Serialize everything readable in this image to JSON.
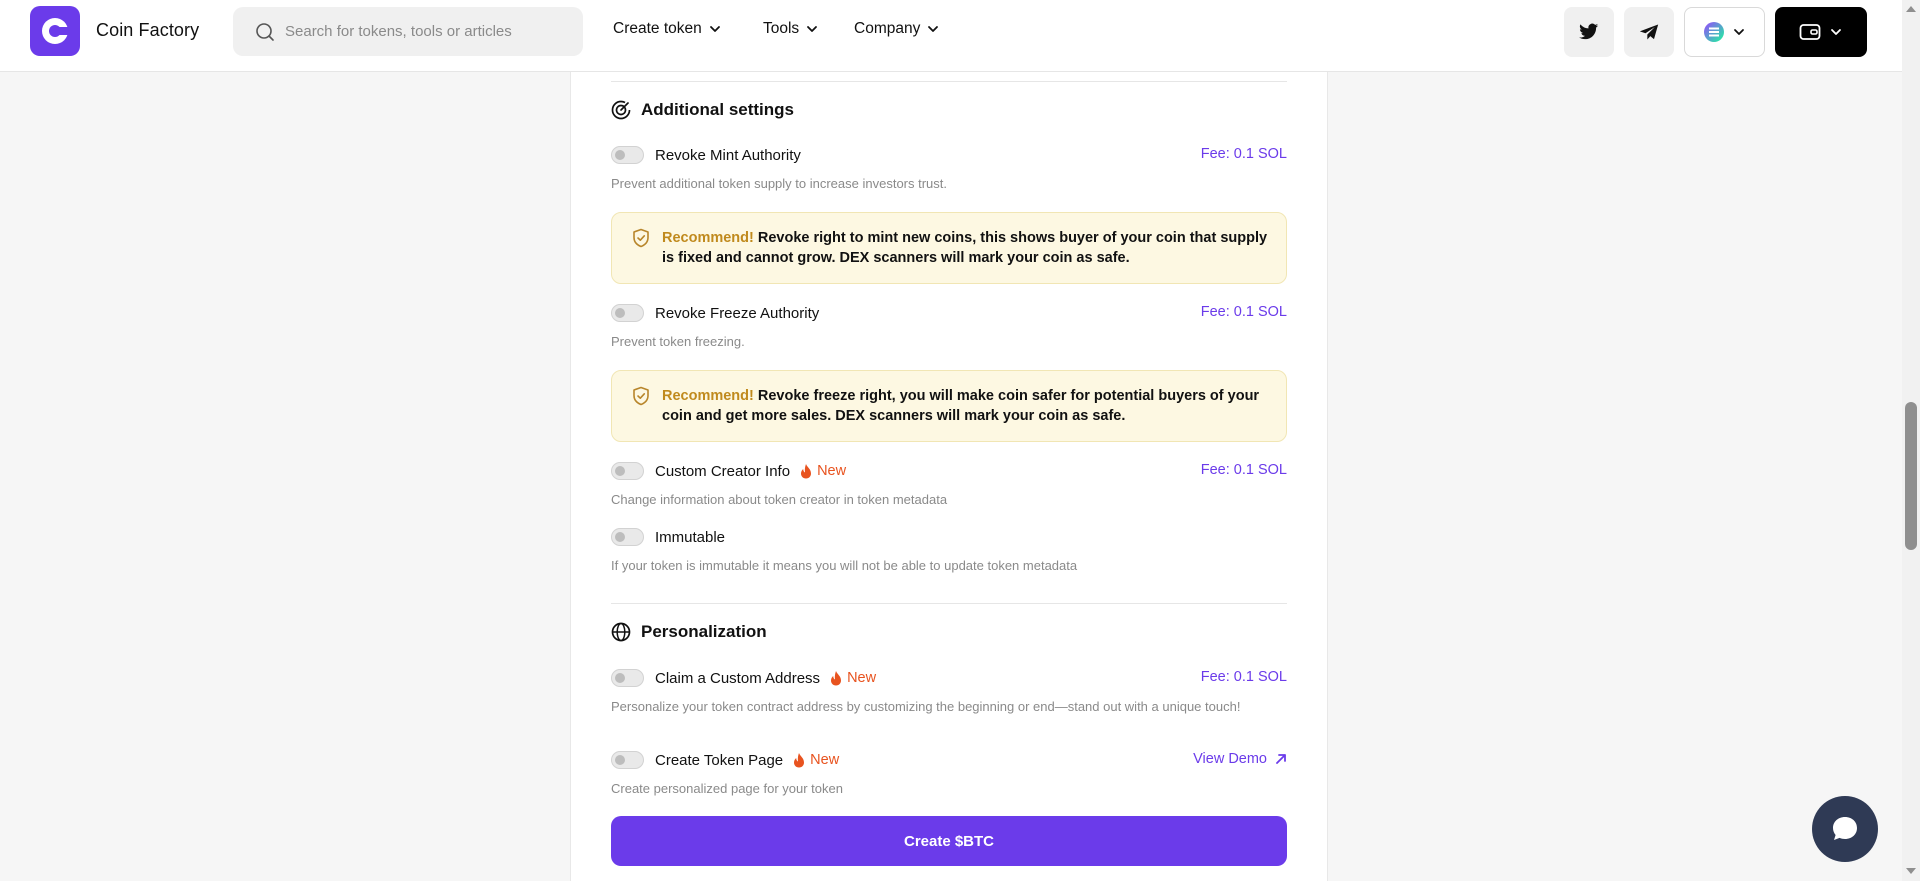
{
  "header": {
    "brand": "Coin Factory",
    "search_placeholder": "Search for tokens, tools or articles",
    "nav": [
      {
        "label": "Create token"
      },
      {
        "label": "Tools"
      },
      {
        "label": "Company"
      }
    ]
  },
  "additional_settings": {
    "title": "Additional settings",
    "revoke_mint": {
      "label": "Revoke Mint Authority",
      "fee": "Fee: 0.1 SOL",
      "description": "Prevent additional token supply to increase investors trust.",
      "recommend_prefix": "Recommend!",
      "recommend_text": " Revoke right to mint new coins, this shows buyer of your coin that supply is fixed and cannot grow. DEX scanners will mark your coin as safe."
    },
    "revoke_freeze": {
      "label": "Revoke Freeze Authority",
      "fee": "Fee: 0.1 SOL",
      "description": "Prevent token freezing.",
      "recommend_prefix": "Recommend!",
      "recommend_text": " Revoke freeze right, you will make coin safer for potential buyers of your coin and get more sales. DEX scanners will mark your coin as safe."
    },
    "custom_creator": {
      "label": "Custom Creator Info",
      "badge": "New",
      "fee": "Fee: 0.1 SOL",
      "description": "Change information about token creator in token metadata"
    },
    "immutable": {
      "label": "Immutable",
      "description": "If your token is immutable it means you will not be able to update token metadata"
    }
  },
  "personalization": {
    "title": "Personalization",
    "custom_address": {
      "label": "Claim a Custom Address",
      "badge": "New",
      "fee": "Fee: 0.1 SOL",
      "description": "Personalize your token contract address by customizing the beginning or end—stand out with a unique touch!"
    },
    "token_page": {
      "label": "Create Token Page",
      "badge": "New",
      "link": "View Demo",
      "description": "Create personalized page for your token"
    }
  },
  "create_button": "Create $BTC",
  "colors": {
    "accent": "#6b3bea",
    "new_badge": "#e8531f",
    "recommend_bg": "#fdf8e2",
    "recommend_highlight": "#c08a1d"
  }
}
